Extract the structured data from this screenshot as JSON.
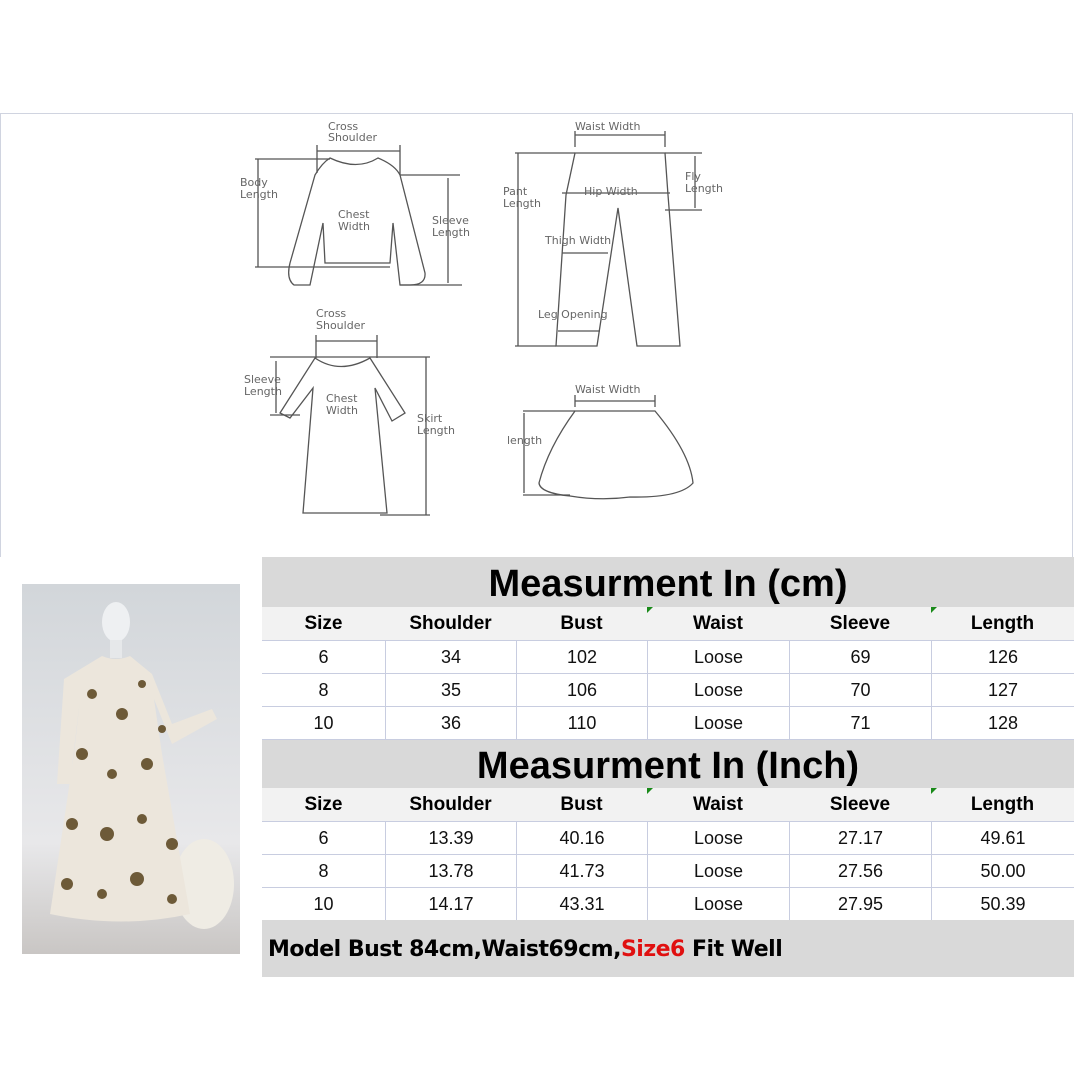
{
  "diagram": {
    "top_cross_shoulder": [
      "Cross",
      "Shoulder"
    ],
    "body_length": [
      "Body",
      "Length"
    ],
    "chest_width": [
      "Chest",
      "Width"
    ],
    "sleeve_length": [
      "Sleeve",
      "Length"
    ],
    "waist_width": "Waist Width",
    "pant_length": [
      "Pant",
      "Length"
    ],
    "hip_width": "Hip Width",
    "fly_length": [
      "Fly",
      "Length"
    ],
    "thigh_width": "Thigh Width",
    "leg_opening": "Leg Opening",
    "dress_cross_shoulder": [
      "Cross",
      "Shoulder"
    ],
    "dress_sleeve_length": [
      "Sleeve",
      "Length"
    ],
    "dress_chest_width": [
      "Chest",
      "Width"
    ],
    "skirt_length": [
      "Skirt",
      "Length"
    ],
    "skirt_waist_width": "Waist Width",
    "skirt_length_label": "length"
  },
  "columns": [
    "Size",
    "Shoulder",
    "Bust",
    "Waist",
    "Sleeve",
    "Length"
  ],
  "cm_table": {
    "title": "Measurment In (cm)",
    "rows": [
      [
        "6",
        "34",
        "102",
        "Loose",
        "69",
        "126"
      ],
      [
        "8",
        "35",
        "106",
        "Loose",
        "70",
        "127"
      ],
      [
        "10",
        "36",
        "110",
        "Loose",
        "71",
        "128"
      ]
    ]
  },
  "inch_table": {
    "title": "Measurment In (Inch)",
    "rows": [
      [
        "6",
        "13.39",
        "40.16",
        "Loose",
        "27.17",
        "49.61"
      ],
      [
        "8",
        "13.78",
        "41.73",
        "Loose",
        "27.56",
        "50.00"
      ],
      [
        "10",
        "14.17",
        "43.31",
        "Loose",
        "27.95",
        "50.39"
      ]
    ]
  },
  "footer": {
    "text_before": "Model Bust 84cm,Waist69cm,",
    "highlight": "Size6",
    "text_after": " Fit Well",
    "highlight_color": "#e01010"
  }
}
